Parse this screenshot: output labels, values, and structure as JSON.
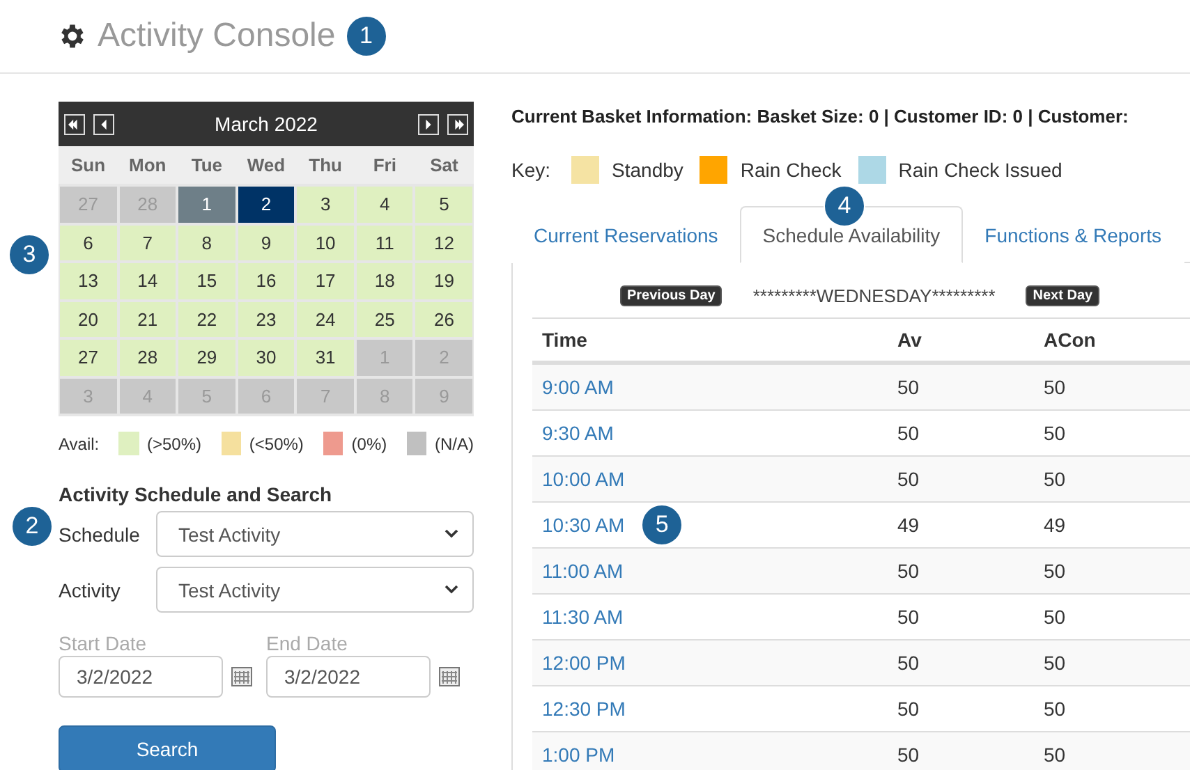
{
  "header": {
    "title": "Activity Console",
    "callout": "1"
  },
  "calendar": {
    "month": "March 2022",
    "callout": "3",
    "weekdays": [
      "Sun",
      "Mon",
      "Tue",
      "Wed",
      "Thu",
      "Fri",
      "Sat"
    ],
    "days": [
      {
        "label": "27",
        "kind": "na",
        "selected": false
      },
      {
        "label": "28",
        "kind": "na",
        "selected": false
      },
      {
        "label": "1",
        "kind": "past",
        "selected": false
      },
      {
        "label": "2",
        "kind": "high",
        "selected": true
      },
      {
        "label": "3",
        "kind": "high",
        "selected": false
      },
      {
        "label": "4",
        "kind": "high",
        "selected": false
      },
      {
        "label": "5",
        "kind": "high",
        "selected": false
      },
      {
        "label": "6",
        "kind": "high",
        "selected": false
      },
      {
        "label": "7",
        "kind": "high",
        "selected": false
      },
      {
        "label": "8",
        "kind": "high",
        "selected": false
      },
      {
        "label": "9",
        "kind": "high",
        "selected": false
      },
      {
        "label": "10",
        "kind": "high",
        "selected": false
      },
      {
        "label": "11",
        "kind": "high",
        "selected": false
      },
      {
        "label": "12",
        "kind": "high",
        "selected": false
      },
      {
        "label": "13",
        "kind": "high",
        "selected": false
      },
      {
        "label": "14",
        "kind": "high",
        "selected": false
      },
      {
        "label": "15",
        "kind": "high",
        "selected": false
      },
      {
        "label": "16",
        "kind": "high",
        "selected": false
      },
      {
        "label": "17",
        "kind": "high",
        "selected": false
      },
      {
        "label": "18",
        "kind": "high",
        "selected": false
      },
      {
        "label": "19",
        "kind": "high",
        "selected": false
      },
      {
        "label": "20",
        "kind": "high",
        "selected": false
      },
      {
        "label": "21",
        "kind": "high",
        "selected": false
      },
      {
        "label": "22",
        "kind": "high",
        "selected": false
      },
      {
        "label": "23",
        "kind": "high",
        "selected": false
      },
      {
        "label": "24",
        "kind": "high",
        "selected": false
      },
      {
        "label": "25",
        "kind": "high",
        "selected": false
      },
      {
        "label": "26",
        "kind": "high",
        "selected": false
      },
      {
        "label": "27",
        "kind": "high",
        "selected": false
      },
      {
        "label": "28",
        "kind": "high",
        "selected": false
      },
      {
        "label": "29",
        "kind": "high",
        "selected": false
      },
      {
        "label": "30",
        "kind": "high",
        "selected": false
      },
      {
        "label": "31",
        "kind": "high",
        "selected": false
      },
      {
        "label": "1",
        "kind": "na",
        "selected": false
      },
      {
        "label": "2",
        "kind": "na",
        "selected": false
      },
      {
        "label": "3",
        "kind": "na",
        "selected": false
      },
      {
        "label": "4",
        "kind": "na",
        "selected": false
      },
      {
        "label": "5",
        "kind": "na",
        "selected": false
      },
      {
        "label": "6",
        "kind": "na",
        "selected": false
      },
      {
        "label": "7",
        "kind": "na",
        "selected": false
      },
      {
        "label": "8",
        "kind": "na",
        "selected": false
      },
      {
        "label": "9",
        "kind": "na",
        "selected": false
      }
    ],
    "legend_label": "Avail:",
    "legend": [
      {
        "label": "(>50%)",
        "color": "#dff0c0"
      },
      {
        "label": "(<50%)",
        "color": "#f5e09e"
      },
      {
        "label": "(0%)",
        "color": "#ee9a8e"
      },
      {
        "label": "(N/A)",
        "color": "#c0c0c0"
      }
    ]
  },
  "search": {
    "title": "Activity Schedule and Search",
    "callout": "2",
    "schedule": {
      "label": "Schedule",
      "value": "Test Activity"
    },
    "activity": {
      "label": "Activity",
      "value": "Test Activity"
    },
    "start_date": {
      "label": "Start Date",
      "value": "3/2/2022"
    },
    "end_date": {
      "label": "End Date",
      "value": "3/2/2022"
    },
    "button": "Search"
  },
  "basket_info": "Current Basket Information: Basket Size: 0 | Customer ID: 0 | Customer:",
  "key": {
    "label": "Key:",
    "items": [
      {
        "label": "Standby",
        "color": "#f5e3a3"
      },
      {
        "label": "Rain Check",
        "color": "#ffa500"
      },
      {
        "label": "Rain Check Issued",
        "color": "#add8e6"
      }
    ]
  },
  "tabs": [
    {
      "label": "Current Reservations",
      "selected": false
    },
    {
      "label": "Schedule Availability",
      "selected": true,
      "callout": "4"
    },
    {
      "label": "Functions & Reports",
      "selected": false
    }
  ],
  "day_nav": {
    "previous": "Previous Day",
    "day": "*********WEDNESDAY*********",
    "next": "Next Day"
  },
  "table": {
    "columns": [
      "Time",
      "Av",
      "ACon"
    ],
    "rows": [
      {
        "time": "9:00 AM",
        "av": "50",
        "acon": "50"
      },
      {
        "time": "9:30 AM",
        "av": "50",
        "acon": "50"
      },
      {
        "time": "10:00 AM",
        "av": "50",
        "acon": "50"
      },
      {
        "time": "10:30 AM",
        "av": "49",
        "acon": "49",
        "callout": "5"
      },
      {
        "time": "11:00 AM",
        "av": "50",
        "acon": "50"
      },
      {
        "time": "11:30 AM",
        "av": "50",
        "acon": "50"
      },
      {
        "time": "12:00 PM",
        "av": "50",
        "acon": "50"
      },
      {
        "time": "12:30 PM",
        "av": "50",
        "acon": "50"
      },
      {
        "time": "1:00 PM",
        "av": "50",
        "acon": "50"
      }
    ]
  }
}
